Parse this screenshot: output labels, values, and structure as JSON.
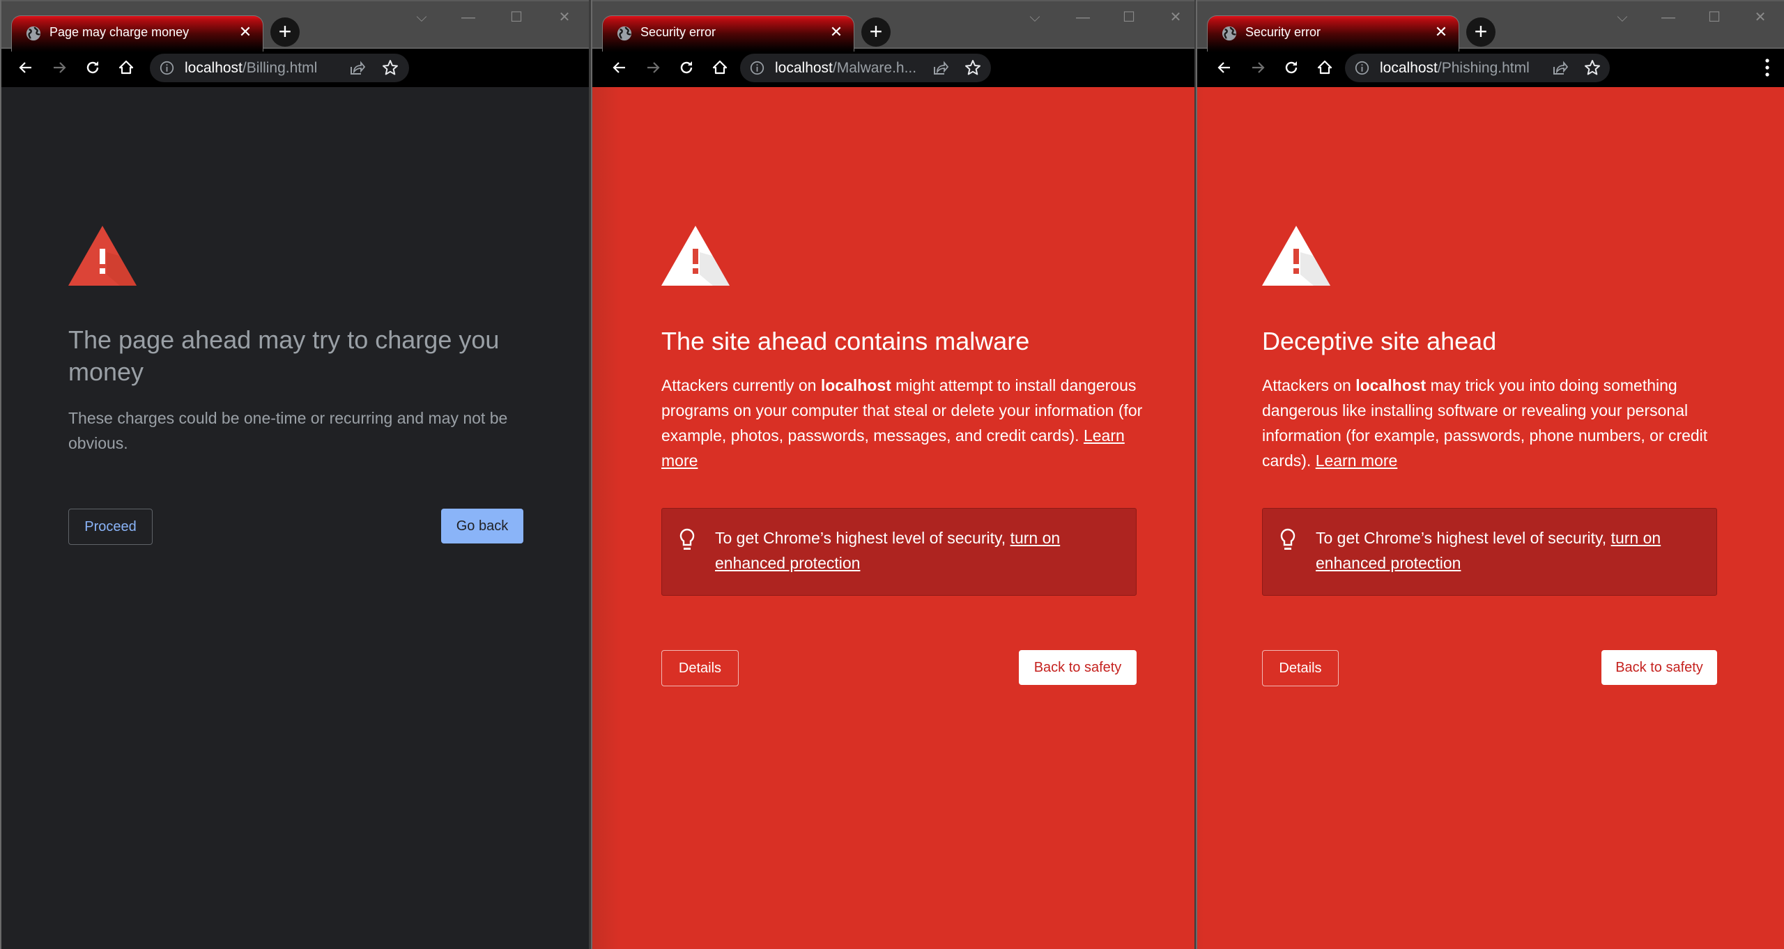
{
  "colors": {
    "interstitial_red": "#d93025",
    "dark_bg": "#202124",
    "info_box": "#ae2420",
    "proceed_text": "#8ab4f8",
    "goback_bg": "#8ab4f8",
    "back_to_safety_text": "#c5221f"
  },
  "windows": [
    {
      "tab": {
        "title": "Page may charge money",
        "favicon": "globe-icon",
        "close": "✕"
      },
      "new_tab": "+",
      "controls": {
        "tab_search": "⌵",
        "minimize": "—",
        "maximize": "☐",
        "close": "✕"
      },
      "url": {
        "host": "localhost",
        "path": "/Billing.html"
      },
      "page": {
        "icon": "warning-triangle-icon",
        "heading": "The page ahead may try to charge you money",
        "body": "These charges could be one-time or recurring and may not be obvious.",
        "buttons": {
          "proceed": "Proceed",
          "go_back": "Go back"
        }
      }
    },
    {
      "tab": {
        "title": "Security error",
        "favicon": "globe-icon",
        "close": "✕"
      },
      "new_tab": "+",
      "controls": {
        "tab_search": "⌵",
        "minimize": "—",
        "maximize": "☐",
        "close": "✕"
      },
      "url": {
        "host": "localhost",
        "path": "/Malware.h..."
      },
      "page": {
        "icon": "warning-triangle-icon",
        "heading": "The site ahead contains malware",
        "body_prefix": "Attackers currently on ",
        "body_bold": "localhost",
        "body_suffix": " might attempt to install dangerous programs on your computer that steal or delete your information (for example, photos, passwords, messages, and credit cards). ",
        "learn_more": "Learn more",
        "info_prefix": "To get Chrome’s highest level of security, ",
        "info_link": "turn on enhanced protection",
        "buttons": {
          "details": "Details",
          "back_to_safety": "Back to safety"
        }
      }
    },
    {
      "tab": {
        "title": "Security error",
        "favicon": "globe-icon",
        "close": "✕"
      },
      "new_tab": "+",
      "controls": {
        "tab_search": "⌵",
        "minimize": "—",
        "maximize": "☐",
        "close": "✕"
      },
      "url": {
        "host": "localhost",
        "path": "/Phishing.html"
      },
      "page": {
        "icon": "warning-triangle-icon",
        "heading": "Deceptive site ahead",
        "body_prefix": "Attackers on ",
        "body_bold": "localhost",
        "body_suffix": " may trick you into doing something dangerous like installing software or revealing your personal information (for example, passwords, phone numbers, or credit cards). ",
        "learn_more": "Learn more",
        "info_prefix": "To get Chrome’s highest level of security, ",
        "info_link": "turn on enhanced protection",
        "buttons": {
          "details": "Details",
          "back_to_safety": "Back to safety"
        }
      }
    }
  ]
}
